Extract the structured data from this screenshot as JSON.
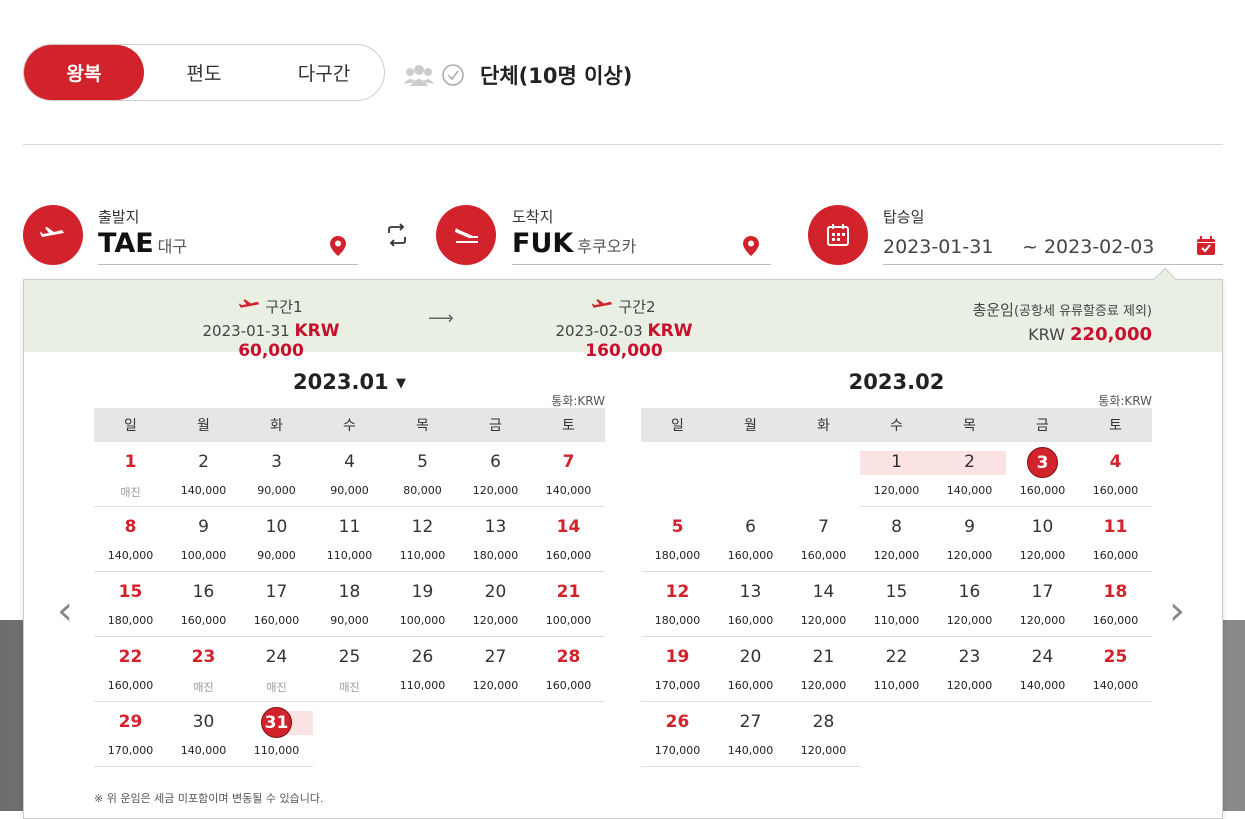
{
  "trip_tabs": [
    "왕복",
    "편도",
    "다구간"
  ],
  "group_label": "단체(10명 이상)",
  "origin": {
    "label": "출발지",
    "code": "TAE",
    "city": "대구"
  },
  "destination": {
    "label": "도착지",
    "code": "FUK",
    "city": "후쿠오카"
  },
  "dates": {
    "label": "탑승일",
    "depart": "2023-01-31",
    "return": "~ 2023-02-03"
  },
  "summary": {
    "seg1": {
      "label": "구간1",
      "date": "2023-01-31",
      "price": "KRW 60,000"
    },
    "seg2": {
      "label": "구간2",
      "date": "2023-02-03",
      "price": "KRW 160,000"
    },
    "total_label": "총운임",
    "total_note": "(공항세 유류할증료 제외)",
    "total_currency": "KRW",
    "total_price": "220,000"
  },
  "weekdays": [
    "일",
    "월",
    "화",
    "수",
    "목",
    "금",
    "토"
  ],
  "currency_label": "통화:KRW",
  "note": "※ 위 운임은 세금 미포함이며 변동될 수 있습니다.",
  "cal1": {
    "title": "2023.01",
    "weeks": [
      [
        {
          "d": "1",
          "p": "매진",
          "r": 1,
          "s": 1
        },
        {
          "d": "2",
          "p": "140,000"
        },
        {
          "d": "3",
          "p": "90,000"
        },
        {
          "d": "4",
          "p": "90,000"
        },
        {
          "d": "5",
          "p": "80,000"
        },
        {
          "d": "6",
          "p": "120,000"
        },
        {
          "d": "7",
          "p": "140,000",
          "r": 1
        }
      ],
      [
        {
          "d": "8",
          "p": "140,000",
          "r": 1
        },
        {
          "d": "9",
          "p": "100,000"
        },
        {
          "d": "10",
          "p": "90,000"
        },
        {
          "d": "11",
          "p": "110,000"
        },
        {
          "d": "12",
          "p": "110,000"
        },
        {
          "d": "13",
          "p": "180,000"
        },
        {
          "d": "14",
          "p": "160,000",
          "r": 1
        }
      ],
      [
        {
          "d": "15",
          "p": "180,000",
          "r": 1
        },
        {
          "d": "16",
          "p": "160,000"
        },
        {
          "d": "17",
          "p": "160,000"
        },
        {
          "d": "18",
          "p": "90,000"
        },
        {
          "d": "19",
          "p": "100,000"
        },
        {
          "d": "20",
          "p": "120,000"
        },
        {
          "d": "21",
          "p": "100,000",
          "r": 1
        }
      ],
      [
        {
          "d": "22",
          "p": "160,000",
          "r": 1
        },
        {
          "d": "23",
          "p": "매진",
          "r": 1,
          "s": 1
        },
        {
          "d": "24",
          "p": "매진",
          "s": 1
        },
        {
          "d": "25",
          "p": "매진",
          "s": 1
        },
        {
          "d": "26",
          "p": "110,000"
        },
        {
          "d": "27",
          "p": "120,000"
        },
        {
          "d": "28",
          "p": "160,000",
          "r": 1
        }
      ],
      [
        {
          "d": "29",
          "p": "170,000",
          "r": 1
        },
        {
          "d": "30",
          "p": "140,000"
        },
        {
          "d": "31",
          "p": "110,000",
          "sel": 1,
          "hlr": 1
        },
        null,
        null,
        null,
        null
      ]
    ]
  },
  "cal2": {
    "title": "2023.02",
    "weeks": [
      [
        null,
        null,
        null,
        {
          "d": "1",
          "p": "120,000",
          "hl": 1
        },
        {
          "d": "2",
          "p": "140,000",
          "hl": 1
        },
        {
          "d": "3",
          "p": "160,000",
          "sel": 1
        },
        {
          "d": "4",
          "p": "160,000",
          "r": 1
        }
      ],
      [
        {
          "d": "5",
          "p": "180,000",
          "r": 1
        },
        {
          "d": "6",
          "p": "160,000"
        },
        {
          "d": "7",
          "p": "160,000"
        },
        {
          "d": "8",
          "p": "120,000"
        },
        {
          "d": "9",
          "p": "120,000"
        },
        {
          "d": "10",
          "p": "120,000"
        },
        {
          "d": "11",
          "p": "160,000",
          "r": 1
        }
      ],
      [
        {
          "d": "12",
          "p": "180,000",
          "r": 1
        },
        {
          "d": "13",
          "p": "160,000"
        },
        {
          "d": "14",
          "p": "120,000"
        },
        {
          "d": "15",
          "p": "110,000"
        },
        {
          "d": "16",
          "p": "120,000"
        },
        {
          "d": "17",
          "p": "120,000"
        },
        {
          "d": "18",
          "p": "160,000",
          "r": 1
        }
      ],
      [
        {
          "d": "19",
          "p": "170,000",
          "r": 1
        },
        {
          "d": "20",
          "p": "160,000"
        },
        {
          "d": "21",
          "p": "120,000"
        },
        {
          "d": "22",
          "p": "110,000"
        },
        {
          "d": "23",
          "p": "120,000"
        },
        {
          "d": "24",
          "p": "140,000"
        },
        {
          "d": "25",
          "p": "140,000",
          "r": 1
        }
      ],
      [
        {
          "d": "26",
          "p": "170,000",
          "r": 1
        },
        {
          "d": "27",
          "p": "140,000"
        },
        {
          "d": "28",
          "p": "120,000"
        },
        null,
        null,
        null,
        null
      ]
    ]
  },
  "colors": {
    "accent": "#d2222b",
    "summary_bg": "#e9efe3"
  }
}
